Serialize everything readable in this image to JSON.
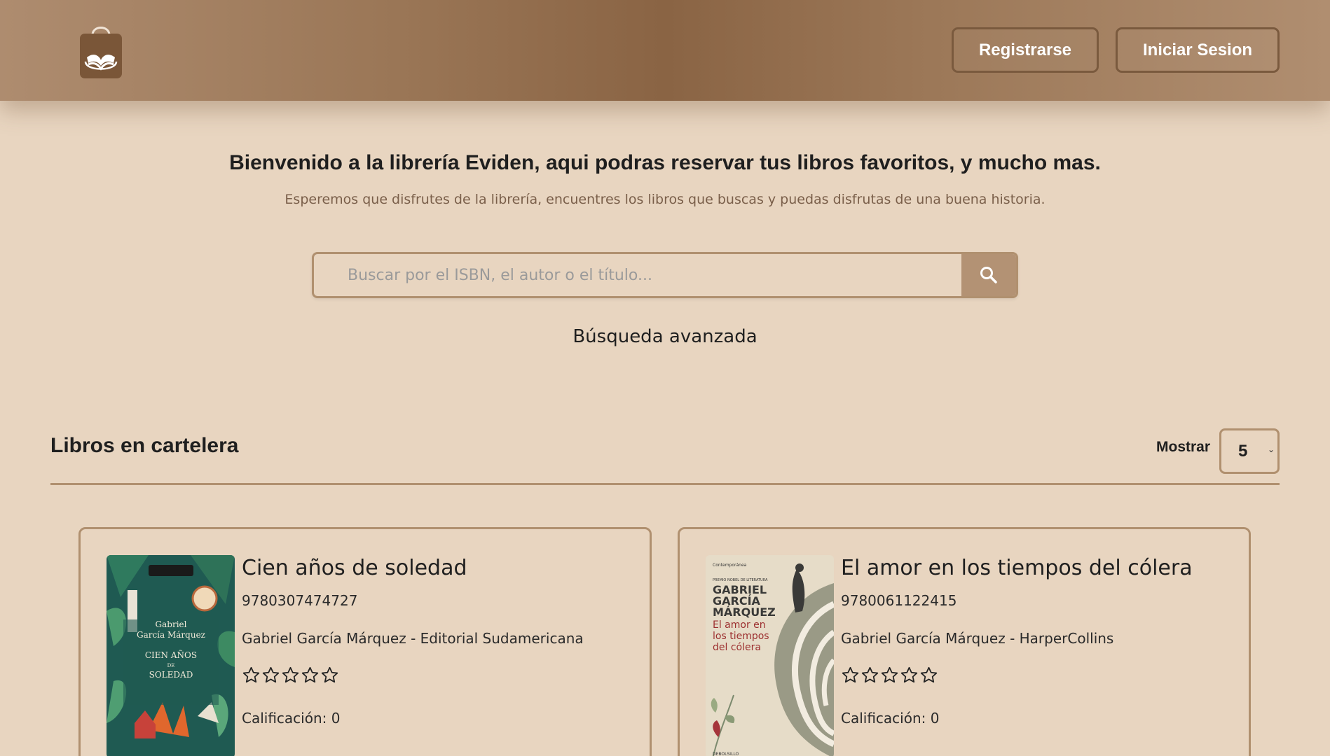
{
  "header": {
    "logo_icon": "book-bag-icon",
    "register_label": "Registrarse",
    "login_label": "Iniciar Sesion"
  },
  "welcome": {
    "title": "Bienvenido a la librería Eviden, aqui podras reservar tus libros favoritos, y mucho mas.",
    "subtitle": "Esperemos que disfrutes de la librería, encuentres los libros que buscas y puedas disfrutas de una buena historia."
  },
  "search": {
    "placeholder": "Buscar por el ISBN, el autor o el título...",
    "value": "",
    "button_icon": "search-icon",
    "advanced_label": "Búsqueda avanzada"
  },
  "catalog": {
    "title": "Libros en cartelera",
    "show_label": "Mostrar",
    "show_value": "5",
    "books": [
      {
        "title": "Cien años de soledad",
        "isbn": "9780307474727",
        "author_publisher": "Gabriel García Márquez - Editorial Sudamericana",
        "stars_filled": 0,
        "stars_total": 5,
        "rating_text": "Calificación: 0",
        "cover_text": [
          "Gabriel",
          "García Márquez",
          "CIEN AÑOS",
          "DE",
          "SOLEDAD"
        ]
      },
      {
        "title": "El amor en los tiempos del cólera",
        "isbn": "9780061122415",
        "author_publisher": "Gabriel García Márquez - HarperCollins",
        "stars_filled": 0,
        "stars_total": 5,
        "rating_text": "Calificación: 0",
        "cover_text": [
          "GABRIEL",
          "GARCÍA",
          "MÁRQUEZ",
          "El amor en",
          "los tiempos",
          "del cólera"
        ]
      }
    ]
  },
  "colors": {
    "background": "#e8d5c0",
    "header": "#9a7656",
    "accent": "#b0906f",
    "search_button": "#b39274"
  }
}
